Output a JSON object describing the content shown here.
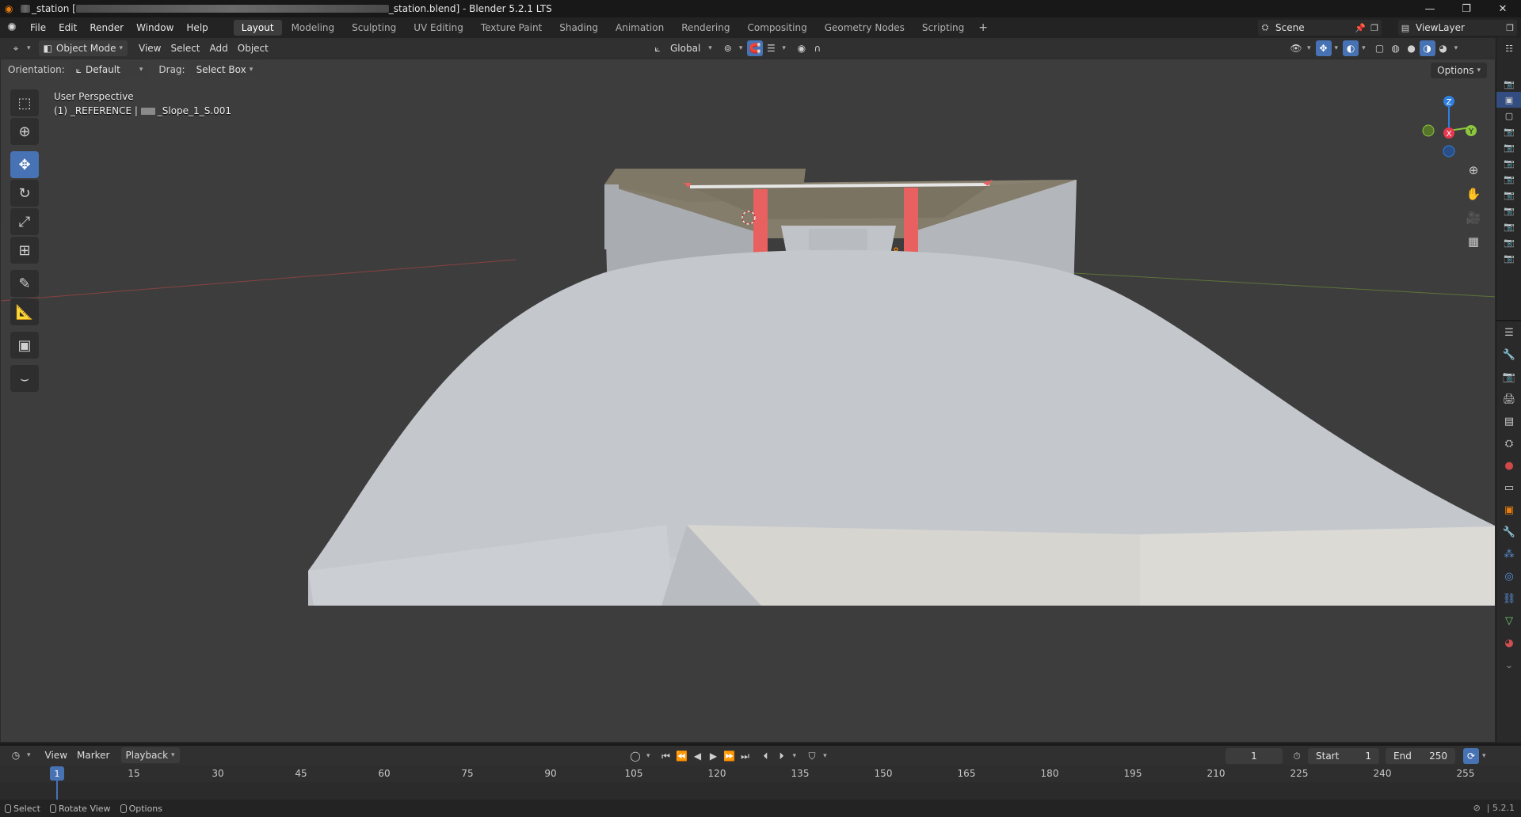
{
  "window": {
    "title_prefix": "_station [",
    "title_suffix": "_station.blend] - Blender 5.2.1 LTS",
    "controls": [
      "—",
      "❐",
      "✕"
    ]
  },
  "menu": {
    "items": [
      "File",
      "Edit",
      "Render",
      "Window",
      "Help"
    ]
  },
  "workspaces": {
    "tabs": [
      "Layout",
      "Modeling",
      "Sculpting",
      "UV Editing",
      "Texture Paint",
      "Shading",
      "Animation",
      "Rendering",
      "Compositing",
      "Geometry Nodes",
      "Scripting"
    ],
    "active": "Layout",
    "add": "+"
  },
  "scene": {
    "label": "Scene"
  },
  "view_layer": {
    "label": "ViewLayer"
  },
  "viewport_header": {
    "mode": "Object Mode",
    "menus": [
      "View",
      "Select",
      "Add",
      "Object"
    ],
    "transform_orientation": "Global"
  },
  "tool_settings": {
    "orientation_label": "Orientation:",
    "orientation_value": "Default",
    "drag_label": "Drag:",
    "drag_value": "Select Box",
    "options_label": "Options"
  },
  "viewport_info": {
    "line1": "User Perspective",
    "line2_prefix": "(1) _REFERENCE |",
    "line2_suffix": "_Slope_1_S.001"
  },
  "gizmo": {
    "x": "X",
    "y": "Y",
    "z": "Z"
  },
  "timeline": {
    "menus": [
      "View",
      "Marker",
      "Playback"
    ],
    "current_frame": "1",
    "start_label": "Start",
    "start_value": "1",
    "end_label": "End",
    "end_value": "250",
    "ticks": [
      "1",
      "15",
      "30",
      "45",
      "60",
      "75",
      "90",
      "105",
      "120",
      "135",
      "150",
      "165",
      "180",
      "195",
      "210",
      "225",
      "240",
      "255"
    ]
  },
  "statusbar": {
    "select": "Select",
    "rotate": "Rotate View",
    "options": "Options",
    "version": "5.2.1"
  },
  "colors": {
    "accent": "#4772b3",
    "viewport_bg": "#3d3d3d",
    "pillar": "#e86060",
    "axis_x": "#e8384f",
    "axis_y": "#8cc63f",
    "axis_z": "#2f7fde"
  }
}
